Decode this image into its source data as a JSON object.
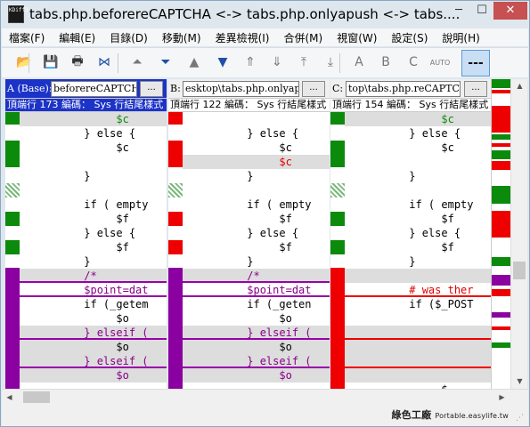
{
  "window": {
    "title": "tabs.php.beforereCAPTCHA <-> tabs.php.onlyapush <-> tabs....",
    "app_icon_text": "KDiff3",
    "min": "─",
    "max": "☐",
    "close": "✕"
  },
  "menu": [
    "檔案(F)",
    "編輯(E)",
    "目錄(D)",
    "移動(M)",
    "差異檢視(I)",
    "合併(M)",
    "視窗(W)",
    "設定(S)",
    "說明(H)"
  ],
  "toolbar": {
    "icons": [
      "open-icon",
      "save-icon",
      "print-icon",
      "bowtie-icon",
      "go-top-icon",
      "go-bottom-icon",
      "go-prev-delta-icon",
      "go-next-delta-icon",
      "go-prev-conflict-icon",
      "go-next-conflict-icon",
      "go-first-unsolved-icon",
      "go-last-unsolved-icon",
      "choose-a-icon",
      "choose-b-icon",
      "choose-c-icon",
      "auto-advance-icon",
      "show-whitespace-icon"
    ],
    "glyphs": [
      "📂",
      "💾",
      "🖶",
      "⋈",
      "⏶",
      "⏷",
      "▲",
      "▼",
      "⇑",
      "⇓",
      "⤒",
      "⤓",
      "A",
      "B",
      "C",
      "AUTO",
      "---"
    ],
    "colors": [
      "#c8901c",
      "#333333",
      "#333333",
      "#1f4fa8",
      "#777777",
      "#1f4fa8",
      "#777777",
      "#1f4fa8",
      "#777777",
      "#777777",
      "#777777",
      "#777777",
      "#777777",
      "#777777",
      "#777777",
      "#777777",
      "#111111"
    ]
  },
  "panes": [
    {
      "label": "A (Base):",
      "path": "beforereCAPTCHA",
      "browse": "...",
      "status": "頂端行 173 編碼： Sys 行結尾樣式",
      "active": true
    },
    {
      "label": "B:",
      "path": "esktop\\tabs.php.onlyapush",
      "browse": "...",
      "status": "頂端行 122 編碼： Sys 行結尾樣式",
      "active": false
    },
    {
      "label": "C:",
      "path": "top\\tabs.php.reCAPTCHA",
      "browse": "...",
      "status": "頂端行 154 編碼： Sys 行結尾樣式",
      "active": false
    }
  ],
  "code": {
    "a": [
      {
        "text": "               $c",
        "cls": "line-grey txt-green"
      },
      {
        "text": "          } else {",
        "cls": ""
      },
      {
        "text": "               $c",
        "cls": ""
      },
      {
        "text": "",
        "cls": ""
      },
      {
        "text": "          }",
        "cls": ""
      },
      {
        "text": "",
        "cls": ""
      },
      {
        "text": "          if ( empty",
        "cls": ""
      },
      {
        "text": "               $f",
        "cls": ""
      },
      {
        "text": "          } else {",
        "cls": ""
      },
      {
        "text": "               $f",
        "cls": ""
      },
      {
        "text": "          }",
        "cls": ""
      },
      {
        "text": "          /*",
        "cls": "line-grey txt-purple under-purple"
      },
      {
        "text": "          $point=dat",
        "cls": "txt-purple under-purple"
      },
      {
        "text": "          if (_getem",
        "cls": ""
      },
      {
        "text": "               $o",
        "cls": ""
      },
      {
        "text": "          }_elseif_(",
        "cls": "line-grey txt-purple under-purple"
      },
      {
        "text": "               $o",
        "cls": "line-grey"
      },
      {
        "text": "          }_elseif_(",
        "cls": "line-grey txt-purple under-purple"
      },
      {
        "text": "               $o",
        "cls": "line-grey txt-purple"
      },
      {
        "text": "",
        "cls": ""
      }
    ],
    "b": [
      {
        "text": "",
        "cls": ""
      },
      {
        "text": "          } else {",
        "cls": ""
      },
      {
        "text": "               $c",
        "cls": ""
      },
      {
        "text": "               $c",
        "cls": "line-grey txt-red"
      },
      {
        "text": "          }",
        "cls": ""
      },
      {
        "text": "",
        "cls": ""
      },
      {
        "text": "          if ( empty",
        "cls": ""
      },
      {
        "text": "               $f",
        "cls": ""
      },
      {
        "text": "          } else {",
        "cls": ""
      },
      {
        "text": "               $f",
        "cls": ""
      },
      {
        "text": "          }",
        "cls": ""
      },
      {
        "text": "          /*",
        "cls": "line-grey txt-purple under-purple"
      },
      {
        "text": "          $point=dat",
        "cls": "txt-purple under-purple"
      },
      {
        "text": "          if (_geten",
        "cls": ""
      },
      {
        "text": "               $o",
        "cls": ""
      },
      {
        "text": "          }_elseif_(",
        "cls": "line-grey txt-purple under-purple"
      },
      {
        "text": "               $o",
        "cls": "line-grey"
      },
      {
        "text": "          }_elseif_(",
        "cls": "line-grey txt-purple under-purple"
      },
      {
        "text": "               $o",
        "cls": "line-grey txt-purple"
      },
      {
        "text": "",
        "cls": ""
      }
    ],
    "c": [
      {
        "text": "               $c",
        "cls": "line-grey txt-green"
      },
      {
        "text": "          } else {",
        "cls": ""
      },
      {
        "text": "               $c",
        "cls": ""
      },
      {
        "text": "",
        "cls": ""
      },
      {
        "text": "          }",
        "cls": ""
      },
      {
        "text": "",
        "cls": ""
      },
      {
        "text": "          if ( empty",
        "cls": ""
      },
      {
        "text": "               $f",
        "cls": ""
      },
      {
        "text": "          } else {",
        "cls": ""
      },
      {
        "text": "               $f",
        "cls": ""
      },
      {
        "text": "          }",
        "cls": ""
      },
      {
        "text": "",
        "cls": "line-grey"
      },
      {
        "text": "          #_was_ther",
        "cls": "txt-red under-red"
      },
      {
        "text": "          if ($_POST",
        "cls": ""
      },
      {
        "text": "",
        "cls": ""
      },
      {
        "text": "",
        "cls": "line-grey under-red"
      },
      {
        "text": "",
        "cls": "line-grey"
      },
      {
        "text": "",
        "cls": "line-grey under-red"
      },
      {
        "text": "",
        "cls": "line-grey"
      },
      {
        "text": "               $",
        "cls": ""
      }
    ]
  },
  "colors": {
    "green": "#0c8a0c",
    "red": "#ee0000",
    "purple": "#8b00a0",
    "hatch": "#7ab87a",
    "active_header": "#1c33c8"
  },
  "watermark": {
    "cn": "綠色工廠",
    "en": "Portable.easylife.tw"
  }
}
